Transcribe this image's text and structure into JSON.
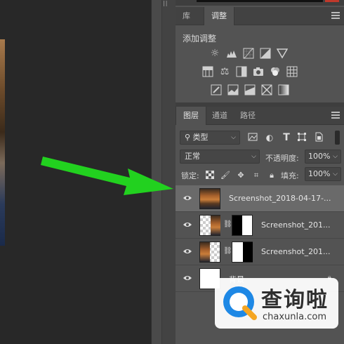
{
  "panel_top": {
    "tabs": [
      {
        "label": "库",
        "active": false
      },
      {
        "label": "调整",
        "active": true
      }
    ]
  },
  "adjustments": {
    "section_title": "添加调整",
    "row1": [
      "brightness-icon",
      "levels-icon",
      "curves-icon",
      "exposure-icon",
      "vibrance-icon"
    ],
    "row2": [
      "hue-saturation-icon",
      "color-balance-icon",
      "black-white-icon",
      "photo-filter-icon",
      "channel-mixer-icon",
      "color-lookup-icon"
    ],
    "row3": [
      "invert-icon",
      "posterize-icon",
      "threshold-icon",
      "selective-color-icon",
      "gradient-map-icon"
    ]
  },
  "layers_panel": {
    "tabs": [
      {
        "label": "图层",
        "active": true
      },
      {
        "label": "通道",
        "active": false
      },
      {
        "label": "路径",
        "active": false
      }
    ],
    "filter_label": "类型",
    "blend_mode": "正常",
    "opacity_label": "不透明度:",
    "opacity_value": "100%",
    "lock_label": "锁定:",
    "fill_label": "填充:",
    "fill_value": "100%",
    "layers": [
      {
        "name": "Screenshot_2018-04-17-...",
        "selected": true
      },
      {
        "name": "Screenshot_201...",
        "selected": false
      },
      {
        "name": "Screenshot_201...",
        "selected": false
      },
      {
        "name": "背景",
        "selected": false
      }
    ]
  },
  "watermark": {
    "title": "查询啦",
    "url": "chaxunla.com"
  },
  "colors": {
    "arrow": "#22d11f",
    "panel_bg": "#535353",
    "selected_layer": "#6a6a6a",
    "watermark_blue": "#1e88e5",
    "watermark_orange": "#f5a623"
  }
}
